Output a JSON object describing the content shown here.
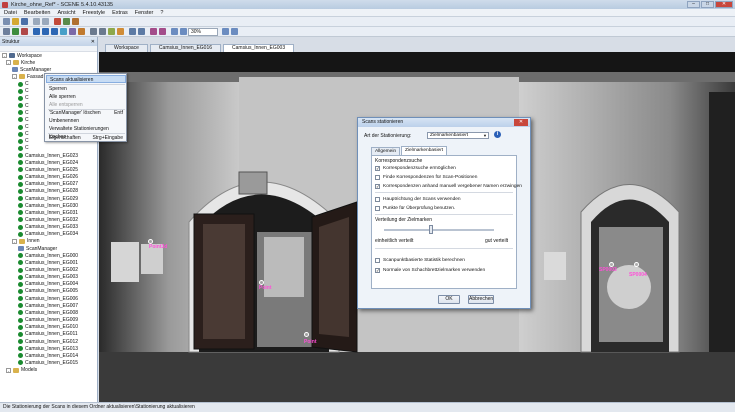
{
  "window": {
    "title": "Kirche_ohne_Ref* - SCENE 5.4.10.43135"
  },
  "menu": [
    "Datei",
    "Bearbeiten",
    "Ansicht",
    "Freestyle",
    "Extras",
    "Fenster",
    "?"
  ],
  "toolbar": {
    "zoom_value": "30%"
  },
  "left_pane": {
    "header": "Struktur",
    "workspace_label": "Workspace",
    "kirche_label": "Kirche",
    "scanmanager_label": "ScanManager",
    "fassade_label": "Fassad",
    "items_group1": [
      "C",
      "C",
      "C",
      "C",
      "C",
      "C",
      "C",
      "C",
      "C",
      "C"
    ],
    "items_group2": [
      "Camsius_Innen_EG023",
      "Camsius_Innen_EG024",
      "Camsius_Innen_EG025",
      "Camsius_Innen_EG026",
      "Camsius_Innen_EG027",
      "Camsius_Innen_EG028",
      "Camsius_Innen_EG029",
      "Camsius_Innen_EG030",
      "Camsius_Innen_EG031",
      "Camsius_Innen_EG032",
      "Camsius_Innen_EG033",
      "Camsius_Innen_EG034"
    ],
    "innen_label": "Innen",
    "innen_scanmanager": "ScanManager",
    "items_innen": [
      "Camsius_Innen_EG000",
      "Camsius_Innen_EG001",
      "Camsius_Innen_EG002",
      "Camsius_Innen_EG003",
      "Camsius_Innen_EG004",
      "Camsius_Innen_EG005",
      "Camsius_Innen_EG006",
      "Camsius_Innen_EG007",
      "Camsius_Innen_EG008",
      "Camsius_Innen_EG009",
      "Camsius_Innen_EG010",
      "Camsius_Innen_EG011",
      "Camsius_Innen_EG012",
      "Camsius_Innen_EG013",
      "Camsius_Innen_EG014",
      "Camsius_Innen_EG015"
    ],
    "models_label": "Models"
  },
  "tabs": [
    "Workspace",
    "Camsius_Innen_EG016",
    "Camsius_Innen_EG003"
  ],
  "context_menu": {
    "items": [
      {
        "label": "Scans aktualisieren",
        "shortcut": ""
      },
      {
        "label": "Sperren",
        "shortcut": ""
      },
      {
        "label": "Alle sperren",
        "shortcut": ""
      },
      {
        "label": "Alle entsperren",
        "shortcut": ""
      },
      {
        "label": "'ScanManager' löschen",
        "shortcut": "Entf"
      },
      {
        "label": "Umbenennen",
        "shortcut": ""
      },
      {
        "label": "Verwaltete Stationierungen löschen",
        "shortcut": ""
      },
      {
        "label": "Eigenschaften",
        "shortcut": "Strg+Eingabe"
      }
    ]
  },
  "dialog": {
    "title": "Scans stationieren",
    "type_label": "Art der Stationierung:",
    "type_value": "Zielmarkenbasiert",
    "tab_general": "Allgemein",
    "tab_target": "Zielmarkenbasiert",
    "section_label": "Korrespondenzsuche",
    "cb1": "Korrespondenzsuche ermöglichen",
    "cb2": "Finde Korrespondenzen für Scan-Positionen",
    "cb3": "Korrespondenzen anhand manuell vergebener Namen erzwingen",
    "cb4": "Hauptrichtung der Scans verwenden",
    "cb5": "Punkte für Überprüfung benutzen.",
    "distribution_label": "Verteilung der Zielmarken",
    "slider_left": "einheitlich verteilt",
    "slider_right": "gut verteilt",
    "cb6": "Scanpunktbasierte Statistik berechnen",
    "cb7": "Normale von Schachbrettzielmarken verwenden",
    "ok": "OK",
    "cancel": "Abbrechen"
  },
  "viewport_labels": [
    "Point3d",
    "Point",
    "Point",
    "SP0003",
    "SP0004"
  ],
  "status": "Die Stationierung der Scans in diesem Ordner aktualisieren\\Stationierung aktualisieren"
}
